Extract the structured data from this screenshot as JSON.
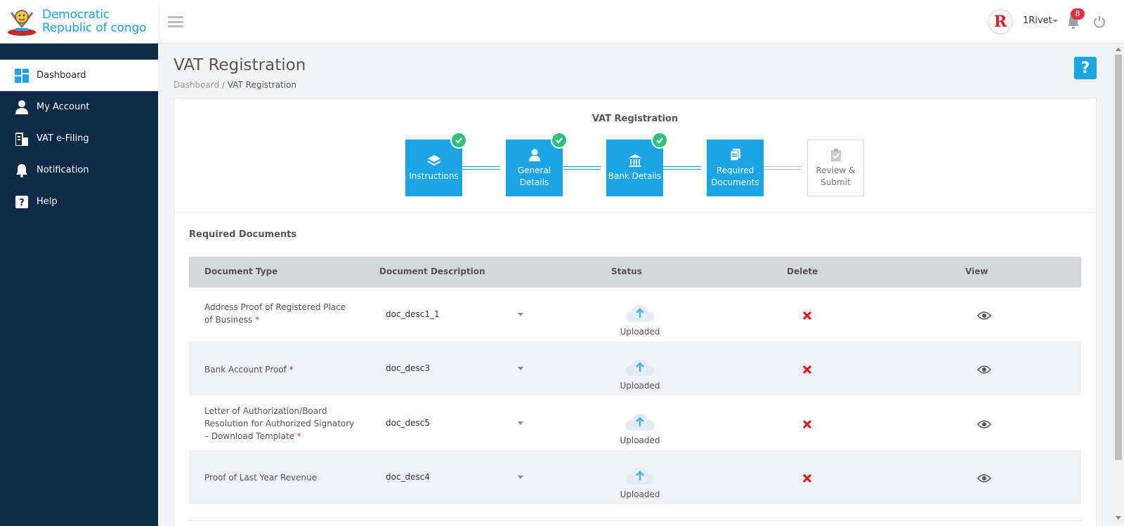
{
  "brand": {
    "line1": "Democratic",
    "line2": "Republic of congo"
  },
  "header": {
    "user_name": "1Rivet",
    "avatar_letter": "R",
    "notification_count": "8",
    "accent_color": "#19a5e6"
  },
  "sidebar": {
    "items": [
      {
        "label": "Dashboard",
        "icon": "dashboard-icon",
        "active": true
      },
      {
        "label": "My Account",
        "icon": "user-icon"
      },
      {
        "label": "VAT e-Filing",
        "icon": "filing-icon"
      },
      {
        "label": "Notification",
        "icon": "bell-icon"
      },
      {
        "label": "Help",
        "icon": "help-icon"
      }
    ]
  },
  "page": {
    "title": "VAT Registration",
    "breadcrumb": {
      "parent": "Dashboard",
      "separator": "/",
      "current": "VAT Registration"
    },
    "help_label": "?"
  },
  "stepper": {
    "title": "VAT Registration",
    "steps": [
      {
        "line1": "Instructions",
        "line2": "",
        "icon": "layers-icon",
        "completed": true
      },
      {
        "line1": "General",
        "line2": "Details",
        "icon": "user-icon",
        "completed": true
      },
      {
        "line1": "Bank Details",
        "line2": "",
        "icon": "bank-icon",
        "completed": true
      },
      {
        "line1": "Required",
        "line2": "Documents",
        "icon": "documents-icon",
        "current": true
      },
      {
        "line1": "Review &",
        "line2": "Submit",
        "icon": "clipboard-icon",
        "pending": true
      }
    ]
  },
  "documents": {
    "section_title": "Required Documents",
    "columns": [
      "Document Type",
      "Document Description",
      "Status",
      "Delete",
      "View"
    ],
    "rows": [
      {
        "type": "Address Proof of Registered Place of Business",
        "required": "*",
        "description": "doc_desc1_1",
        "status": "Uploaded"
      },
      {
        "type": "Bank Account Proof",
        "required": "*",
        "description": "doc_desc3",
        "status": "Uploaded"
      },
      {
        "type": "Letter of Authorization/Board Resolution for Authorized Signatory – Download Template",
        "required": "*",
        "description": "doc_desc5",
        "status": "Uploaded"
      },
      {
        "type": "Proof of Last Year Revenue",
        "required": "",
        "description": "doc_desc4",
        "status": "Uploaded"
      }
    ]
  }
}
